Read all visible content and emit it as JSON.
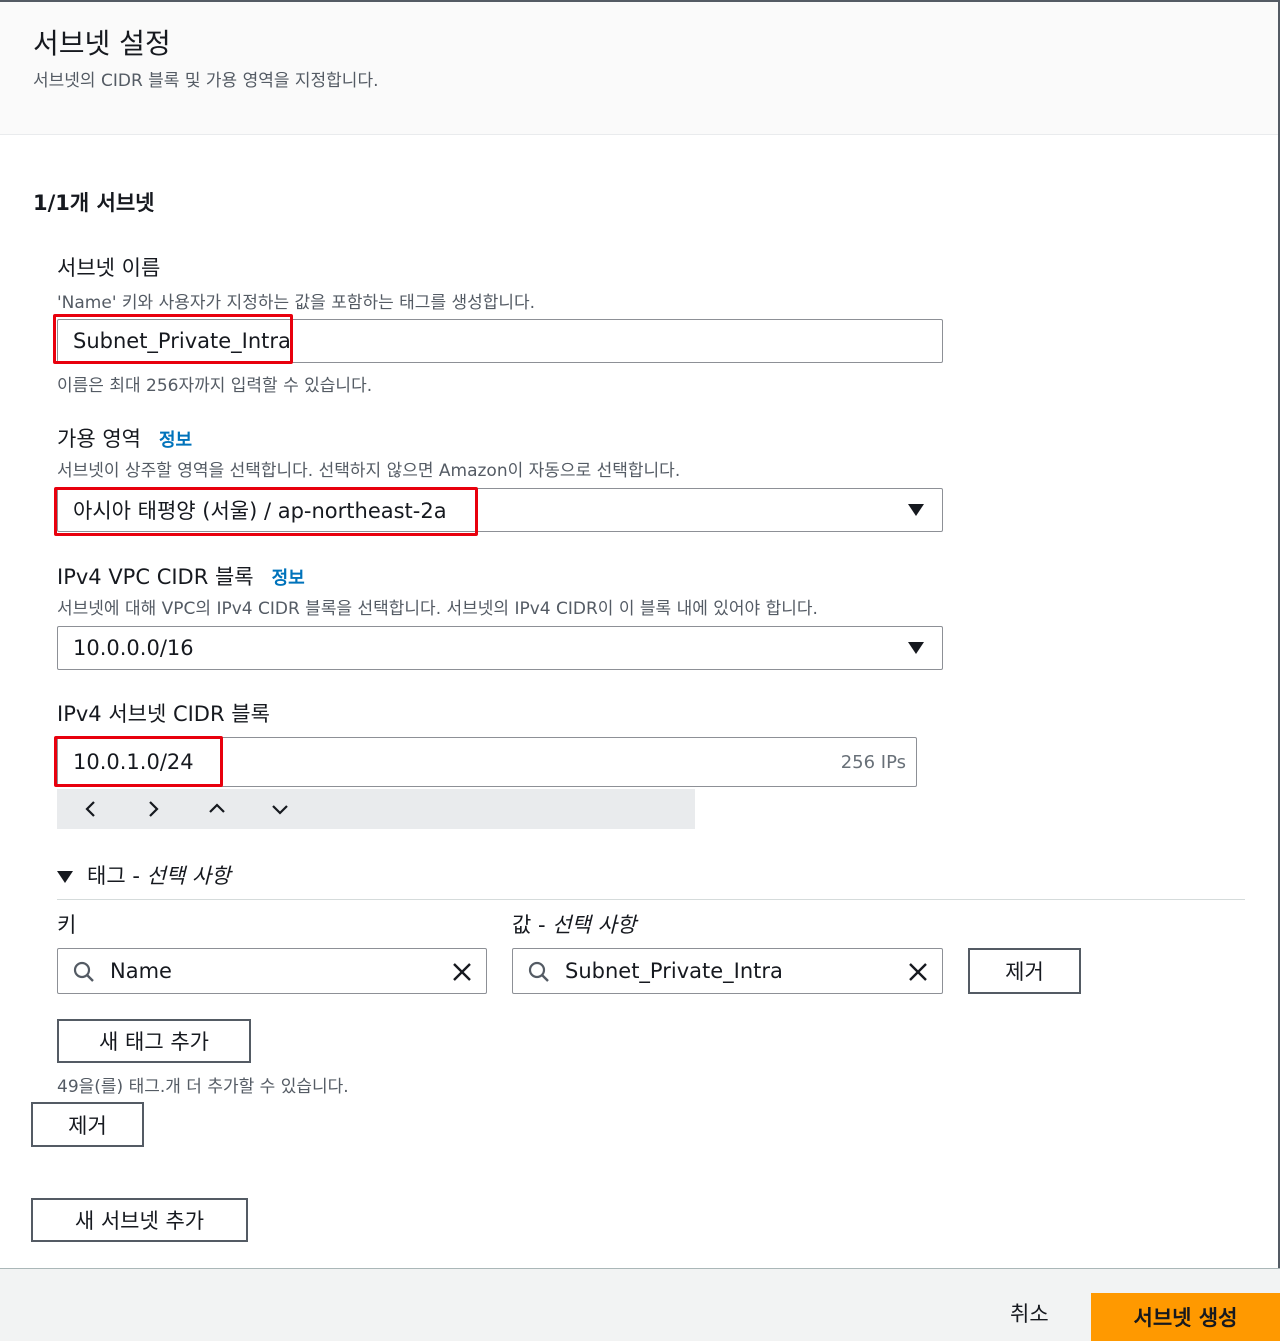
{
  "header": {
    "title": "서브넷 설정",
    "description": "서브넷의 CIDR 블록 및 가용 영역을 지정합니다."
  },
  "subnet_section": {
    "title": "1/1개 서브넷",
    "name": {
      "label": "서브넷 이름",
      "description": "'Name' 키와 사용자가 지정하는 값을 포함하는 태그를 생성합니다.",
      "value": "Subnet_Private_Intra",
      "hint": "이름은 최대 256자까지 입력할 수 있습니다."
    },
    "az": {
      "label": "가용 영역",
      "info": "정보",
      "description": "서브넷이 상주할 영역을 선택합니다. 선택하지 않으면 Amazon이 자동으로 선택합니다.",
      "value": "아시아 태평양 (서울) / ap-northeast-2a"
    },
    "vpc_cidr": {
      "label": "IPv4 VPC CIDR 블록",
      "info": "정보",
      "description": "서브넷에 대해 VPC의 IPv4 CIDR 블록을 선택합니다. 서브넷의 IPv4 CIDR이 이 블록 내에 있어야 합니다.",
      "value": "10.0.0.0/16"
    },
    "subnet_cidr": {
      "label": "IPv4 서브넷 CIDR 블록",
      "value": "10.0.1.0/24",
      "ips": "256 IPs"
    },
    "tags": {
      "title_prefix": "태그 - ",
      "title_optional": "선택 사항",
      "key_label": "키",
      "value_label_prefix": "값 - ",
      "value_label_optional": "선택 사항",
      "key_value": "Name",
      "value_value": "Subnet_Private_Intra",
      "remove_label": "제거",
      "add_tag_label": "새 태그 추가",
      "remaining_text": "49을(를) 태그.개 더 추가할 수 있습니다."
    },
    "remove_subnet_label": "제거"
  },
  "add_subnet_label": "새 서브넷 추가",
  "footer": {
    "cancel_label": "취소",
    "create_label": "서브넷 생성"
  },
  "colors": {
    "accent": "#ff9900",
    "highlight": "#e8000d",
    "link": "#0073bb"
  },
  "icons": [
    "caret-down-icon",
    "chevron-left-icon",
    "chevron-right-icon",
    "chevron-up-icon",
    "chevron-down-icon",
    "search-icon",
    "close-icon"
  ]
}
